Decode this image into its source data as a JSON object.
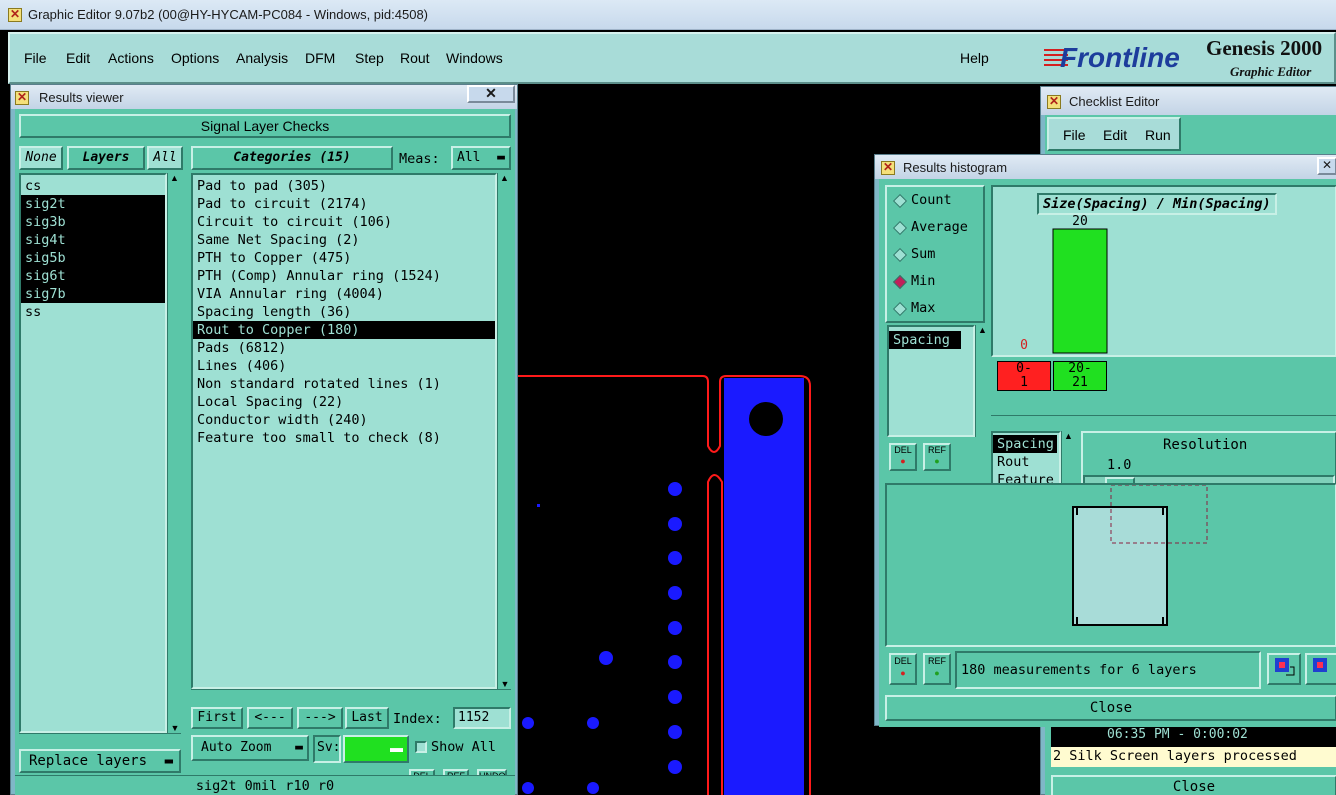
{
  "window": {
    "title": "Graphic Editor 9.07b2 (00@HY-HYCAM-PC084 - Windows, pid:4508)"
  },
  "menu": [
    "File",
    "Edit",
    "Actions",
    "Options",
    "Analysis",
    "DFM",
    "Step",
    "Rout",
    "Windows"
  ],
  "help_label": "Help",
  "brand": {
    "logo": "Frontline",
    "product": "Genesis 2000",
    "subtitle": "Graphic Editor"
  },
  "results_viewer": {
    "title": "Results viewer",
    "header": "Signal Layer Checks",
    "none_label": "None",
    "layers_label": "Layers",
    "all_label": "All",
    "categories_label": "Categories (15)",
    "meas_label": "Meas:",
    "meas_value": "All",
    "layers": [
      {
        "name": "cs",
        "selected": false
      },
      {
        "name": "sig2t",
        "selected": true
      },
      {
        "name": "sig3b",
        "selected": true
      },
      {
        "name": "sig4t",
        "selected": true
      },
      {
        "name": "sig5b",
        "selected": true
      },
      {
        "name": "sig6t",
        "selected": true
      },
      {
        "name": "sig7b",
        "selected": true
      },
      {
        "name": "ss",
        "selected": false
      }
    ],
    "categories": [
      {
        "label": "Pad to pad (305)",
        "selected": false
      },
      {
        "label": "Pad to circuit (2174)",
        "selected": false
      },
      {
        "label": "Circuit to circuit (106)",
        "selected": false
      },
      {
        "label": "Same Net Spacing (2)",
        "selected": false
      },
      {
        "label": "PTH to Copper (475)",
        "selected": false
      },
      {
        "label": "PTH (Comp) Annular ring (1524)",
        "selected": false
      },
      {
        "label": "VIA Annular ring (4004)",
        "selected": false
      },
      {
        "label": "Spacing length (36)",
        "selected": false
      },
      {
        "label": "Rout to Copper (180)",
        "selected": true
      },
      {
        "label": "Pads (6812)",
        "selected": false
      },
      {
        "label": "Lines (406)",
        "selected": false
      },
      {
        "label": "Non standard rotated lines (1)",
        "selected": false
      },
      {
        "label": "Local Spacing (22)",
        "selected": false
      },
      {
        "label": "Conductor width (240)",
        "selected": false
      },
      {
        "label": "Feature too small to check (8)",
        "selected": false
      }
    ],
    "nav": {
      "first": "First",
      "prev": "<---",
      "next": "--->",
      "last": "Last",
      "index_label": "Index:",
      "index_value": "1152"
    },
    "auto_zoom": "Auto Zoom",
    "sv_label": "Sv:",
    "show_all": "Show All",
    "replace_layers": "Replace layers",
    "del": "DEL",
    "ref": "REF",
    "undo": "UNDO",
    "status": "sig2t 0mil  r10  r0"
  },
  "checklist_editor": {
    "title": "Checklist Editor",
    "menu": [
      "File",
      "Edit",
      "Run"
    ],
    "log_time": "06:35 PM - 0:00:02",
    "log_msg": "2 Silk Screen layers processed",
    "close": "Close"
  },
  "histogram": {
    "title": "Results histogram",
    "modes": [
      {
        "label": "Count",
        "on": false
      },
      {
        "label": "Average",
        "on": false
      },
      {
        "label": "Sum",
        "on": false
      },
      {
        "label": "Min",
        "on": true
      },
      {
        "label": "Max",
        "on": false
      }
    ],
    "list": [
      "Spacing"
    ],
    "chart_title": "Size(Spacing) / Min(Spacing)",
    "bars": [
      {
        "count": "0",
        "range": "0-\n1",
        "color": "#ff2020"
      },
      {
        "count": "20",
        "range": "20-\n21",
        "color": "#20e020"
      }
    ],
    "measure_list": [
      {
        "label": "Spacing",
        "selected": true
      },
      {
        "label": "Rout",
        "selected": false
      },
      {
        "label": "Feature",
        "selected": false
      }
    ],
    "resolution_label": "Resolution",
    "resolution_value": "1.0",
    "summary": "180 measurements for 6 layers",
    "close": "Close",
    "del": "DEL",
    "ref": "REF"
  }
}
